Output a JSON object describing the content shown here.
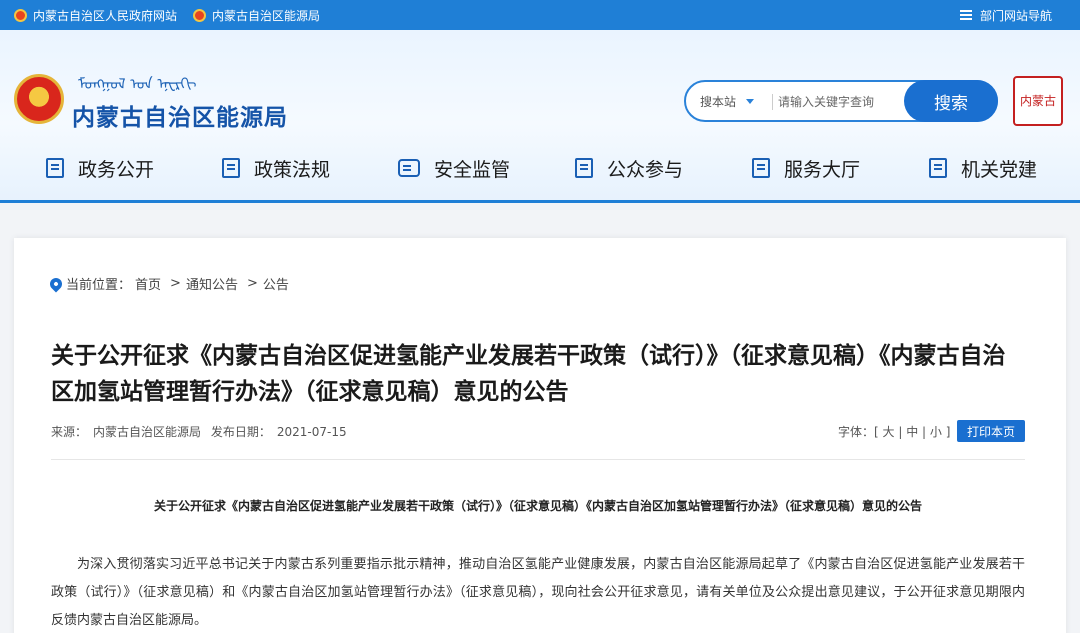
{
  "topbar": {
    "links": [
      "内蒙古自治区人民政府网站",
      "内蒙古自治区能源局"
    ],
    "site_nav": "部门网站导航"
  },
  "header": {
    "mongolian_script": "ᠮᠣᠩᠭᠣᠯ ᠤᠨ ᠡᠨᠧᠷᠭᠢ",
    "site_name": "内蒙古自治区能源局",
    "search_scope": "搜本站",
    "search_placeholder": "请输入关键字查询",
    "search_button": "搜索",
    "seal_text": "内蒙古"
  },
  "nav": [
    {
      "label": "政务公开",
      "icon": "document-icon"
    },
    {
      "label": "政策法规",
      "icon": "policy-icon"
    },
    {
      "label": "安全监管",
      "icon": "chat-icon"
    },
    {
      "label": "公众参与",
      "icon": "participation-icon"
    },
    {
      "label": "服务大厅",
      "icon": "service-icon"
    },
    {
      "label": "机关党建",
      "icon": "party-icon"
    }
  ],
  "breadcrumb": {
    "prefix": "当前位置：",
    "items": [
      "首页",
      "通知公告",
      "公告"
    ],
    "separator": ">"
  },
  "article": {
    "title": "关于公开征求《内蒙古自治区促进氢能产业发展若干政策（试行）》（征求意见稿）《内蒙古自治区加氢站管理暂行办法》（征求意见稿）意见的公告",
    "source_label": "来源：",
    "source": "内蒙古自治区能源局",
    "date_label": "发布日期：",
    "date": "2021-07-15",
    "font_label": "字体：",
    "font_options": [
      "大",
      "中",
      "小"
    ],
    "print_button": "打印本页",
    "sub_title": "关于公开征求《内蒙古自治区促进氢能产业发展若干政策（试行）》（征求意见稿）《内蒙古自治区加氢站管理暂行办法》（征求意见稿）意见的公告",
    "body": "为深入贯彻落实习近平总书记关于内蒙古系列重要指示批示精神，推动自治区氢能产业健康发展，内蒙古自治区能源局起草了《内蒙古自治区促进氢能产业发展若干政策（试行）》（征求意见稿）和《内蒙古自治区加氢站管理暂行办法》（征求意见稿），现向社会公开征求意见，请有关单位及公众提出意见建议，于公开征求意见期限内反馈内蒙古自治区能源局。"
  },
  "colors": {
    "primary": "#1f7fd6",
    "title": "#1554a8",
    "seal": "#c42020"
  }
}
